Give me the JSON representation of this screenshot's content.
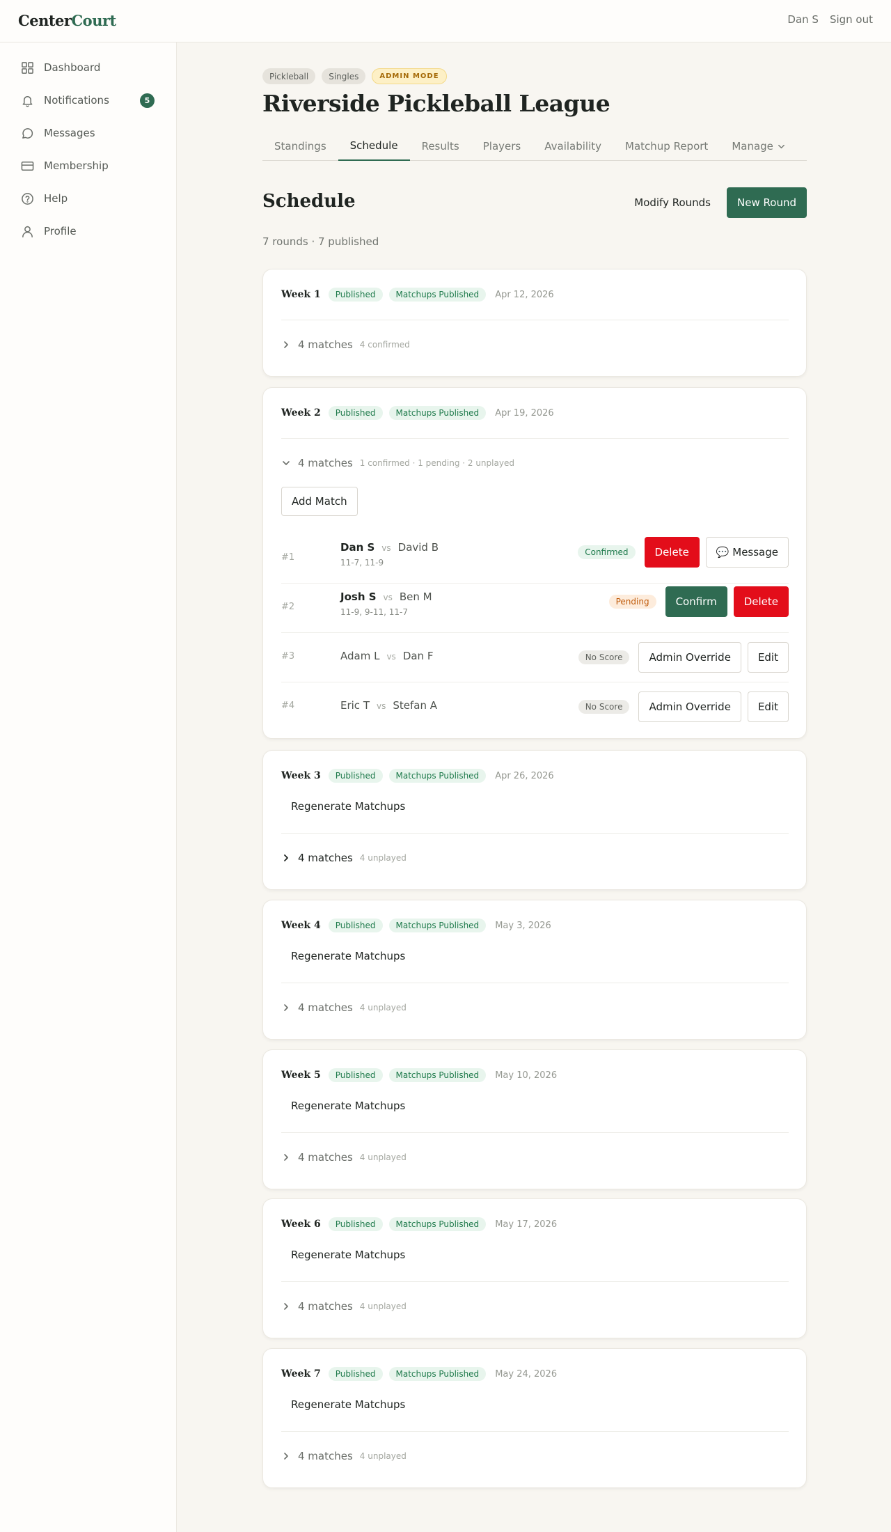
{
  "app": {
    "logo_part1": "Center",
    "logo_part2": "Court",
    "user": "Dan S",
    "signout": "Sign out"
  },
  "sidebar": {
    "items": [
      {
        "label": "Dashboard",
        "icon": "grid-icon"
      },
      {
        "label": "Notifications",
        "icon": "bell-icon",
        "badge": "5"
      },
      {
        "label": "Messages",
        "icon": "message-circle-icon"
      },
      {
        "label": "Membership",
        "icon": "credit-card-icon"
      },
      {
        "label": "Help",
        "icon": "help-circle-icon"
      },
      {
        "label": "Profile",
        "icon": "user-icon"
      }
    ]
  },
  "league": {
    "chips": [
      "Pickleball",
      "Singles",
      "ADMIN MODE"
    ],
    "title": "Riverside Pickleball League",
    "tabs": [
      "Standings",
      "Schedule",
      "Results",
      "Players",
      "Availability",
      "Matchup Report",
      "Manage"
    ],
    "active_tab": "Schedule"
  },
  "schedule": {
    "title": "Schedule",
    "modify_label": "Modify Rounds",
    "new_round_label": "New Round",
    "summary": "7 rounds · 7 published",
    "regen_label": "Regenerate Matchups",
    "add_match_label": "Add Match",
    "weeks": [
      {
        "name": "Week 1",
        "status": "Published",
        "matchups": "Matchups Published",
        "date": "Apr 12, 2026",
        "count": "4 matches",
        "sub": "4 confirmed"
      },
      {
        "name": "Week 2",
        "status": "Published",
        "matchups": "Matchups Published",
        "date": "Apr 19, 2026",
        "count": "4 matches",
        "sub": "1 confirmed · 1 pending · 2 unplayed",
        "matches": [
          {
            "num": "#1",
            "p1": "Dan S",
            "vs": "vs",
            "p2": "David B",
            "score": "11-7, 11-9",
            "status": "Confirmed",
            "a1": "Delete",
            "a2": "💬 Message"
          },
          {
            "num": "#2",
            "p1": "Josh S",
            "vs": "vs",
            "p2": "Ben M",
            "score": "11-9, 9-11, 11-7",
            "status": "Pending",
            "a1": "Confirm",
            "a2": "Delete"
          },
          {
            "num": "#3",
            "p1": "Adam L",
            "vs": "vs",
            "p2": "Dan F",
            "status": "No Score",
            "a1": "Admin Override",
            "a2": "Edit"
          },
          {
            "num": "#4",
            "p1": "Eric T",
            "vs": "vs",
            "p2": "Stefan A",
            "status": "No Score",
            "a1": "Admin Override",
            "a2": "Edit"
          }
        ]
      },
      {
        "name": "Week 3",
        "status": "Published",
        "matchups": "Matchups Published",
        "date": "Apr 26, 2026",
        "count": "4 matches",
        "sub": "4 unplayed"
      },
      {
        "name": "Week 4",
        "status": "Published",
        "matchups": "Matchups Published",
        "date": "May 3, 2026",
        "count": "4 matches",
        "sub": "4 unplayed"
      },
      {
        "name": "Week 5",
        "status": "Published",
        "matchups": "Matchups Published",
        "date": "May 10, 2026",
        "count": "4 matches",
        "sub": "4 unplayed"
      },
      {
        "name": "Week 6",
        "status": "Published",
        "matchups": "Matchups Published",
        "date": "May 17, 2026",
        "count": "4 matches",
        "sub": "4 unplayed"
      },
      {
        "name": "Week 7",
        "status": "Published",
        "matchups": "Matchups Published",
        "date": "May 24, 2026",
        "count": "4 matches",
        "sub": "4 unplayed"
      }
    ]
  },
  "colors": {
    "brand": "#2f6b52",
    "danger": "#e30d1a",
    "background": "#f8f6f1"
  }
}
